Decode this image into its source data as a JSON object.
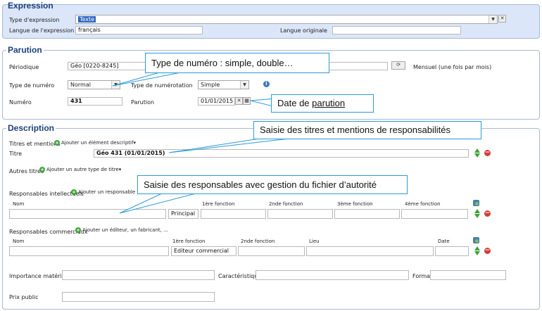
{
  "expression": {
    "legend": "Expression",
    "type_label": "Type d'expression",
    "type_value": "Texte",
    "langue_label": "Langue de l'expression",
    "langue_value": "français",
    "langue_orig_label": "Langue originale",
    "langue_orig_value": ""
  },
  "parution": {
    "legend": "Parution",
    "periodique_label": "Périodique",
    "periodique_value": "Géo [0220-8245]",
    "periodicite": "Mensuel (une fois par mois)",
    "type_numero_label": "Type de numéro",
    "type_numero_value": "Normal",
    "type_numerotation_label": "Type de numérotation",
    "type_numerotation_value": "Simple",
    "numero_label": "Numéro",
    "numero_value": "431",
    "parution_label": "Parution",
    "parution_value": "01/01/2015"
  },
  "description": {
    "legend": "Description",
    "titres_label": "Titres et mentions",
    "add_descriptif": "Ajouter un élément descriptif",
    "titre_label": "Titre",
    "titre_value": "Géo 431 (01/01/2015)",
    "autres_titres_label": "Autres titres",
    "add_autre_titre": "Ajouter un autre type de titre",
    "resp_intel_label": "Responsables intellectuels",
    "add_responsable": "Ajouter un responsable",
    "resp_intel_cols": [
      "Nom",
      "1ère fonction",
      "2nde fonction",
      "3ème fonction",
      "4ème fonction"
    ],
    "resp_intel_role": "Principal",
    "resp_comm_label": "Responsables commerciaux",
    "add_editeur": "Ajouter un éditeur, un fabricant, ...",
    "resp_comm_cols": [
      "Nom",
      "1ère fonction",
      "2nde fonction",
      "Lieu",
      "Date"
    ],
    "resp_comm_fonction": "Editeur commercial",
    "importance_label": "Importance matérielle",
    "caracteristiques_label": "Caractéristiques",
    "format_label": "Format",
    "prix_label": "Prix public"
  },
  "callouts": {
    "type_numero": "Type de numéro : simple, double…",
    "date_parution_prefix": "Date de ",
    "date_parution_underlined": "parution",
    "titres": "Saisie des titres et mentions de responsabilités",
    "responsables": "Saisie des responsables avec gestion du fichier d’autorité"
  },
  "colors": {
    "header_band": "#dbe6f8",
    "legend": "#1c3f7a",
    "callout_border": "#2b9bd9",
    "selection": "#3166c2"
  }
}
